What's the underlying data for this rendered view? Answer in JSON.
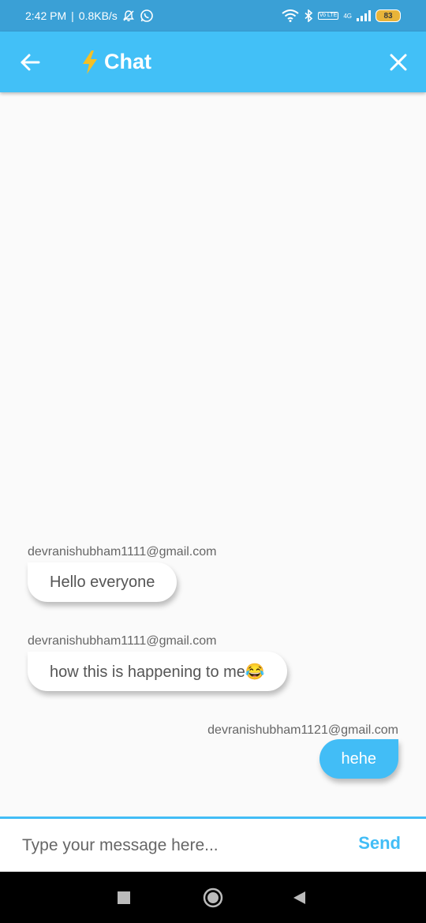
{
  "status_bar": {
    "time": "2:42 PM",
    "separator": "|",
    "net_speed": "0.8KB/s",
    "network": "4G",
    "battery": "83",
    "icons": [
      "mute-icon",
      "whatsapp-icon",
      "wifi-icon",
      "bluetooth-icon",
      "volte-icon",
      "signal-icon",
      "battery-icon"
    ],
    "volte_label": "Vo LTE"
  },
  "app_bar": {
    "title": "Chat",
    "title_icon": "lightning-icon",
    "back_icon": "arrow-left-icon",
    "close_icon": "close-icon",
    "background": "#42c0f7"
  },
  "messages": [
    {
      "sender": "devranishubham1111@gmail.com",
      "text": "Hello everyone",
      "direction": "incoming"
    },
    {
      "sender": "devranishubham1111@gmail.com",
      "text": "how this is happening to me😂",
      "direction": "incoming"
    },
    {
      "sender": "devranishubham1121@gmail.com",
      "text": "hehe",
      "direction": "outgoing"
    }
  ],
  "composer": {
    "placeholder": "Type your message here...",
    "value": "",
    "send_label": "Send",
    "accent": "#42bdf6"
  },
  "nav_bar": {
    "icons": [
      "recents-icon",
      "home-icon",
      "back-icon"
    ]
  }
}
